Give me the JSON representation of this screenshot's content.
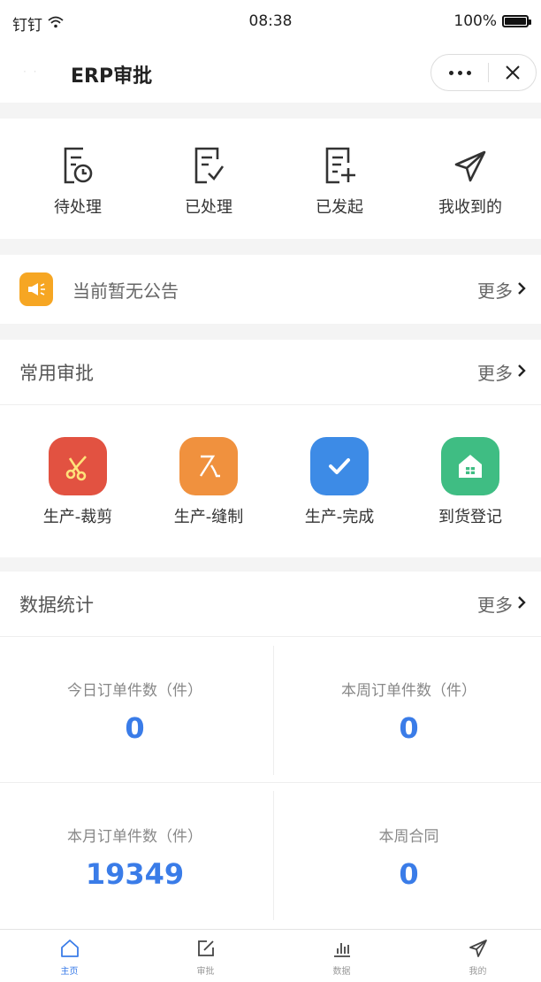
{
  "status_bar": {
    "carrier": "钉钉",
    "time": "08:38",
    "battery": "100%",
    "battery_level": 1.0
  },
  "header": {
    "title": "ERP审批",
    "more_icon": "more-dots-icon",
    "close_icon": "close-icon"
  },
  "quick_actions": [
    {
      "label": "待处理",
      "icon": "pending-clock-icon"
    },
    {
      "label": "已处理",
      "icon": "processed-check-icon"
    },
    {
      "label": "已发起",
      "icon": "initiated-plus-icon"
    },
    {
      "label": "我收到的",
      "icon": "paper-plane-icon"
    }
  ],
  "notice": {
    "text": "当前暂无公告",
    "more": "更多",
    "icon_color": "#f6a623"
  },
  "common_approvals": {
    "title": "常用审批",
    "more": "更多",
    "items": [
      {
        "label": "生产-裁剪",
        "icon": "scissors-icon",
        "color": "#e25241"
      },
      {
        "label": "生产-缝制",
        "icon": "sewing-icon",
        "color": "#f0913e"
      },
      {
        "label": "生产-完成",
        "icon": "check-icon",
        "color": "#3d8be6"
      },
      {
        "label": "到货登记",
        "icon": "house-icon",
        "color": "#3fbd83"
      }
    ]
  },
  "stats": {
    "title": "数据统计",
    "more": "更多",
    "cells": [
      {
        "label": "今日订单件数（件）",
        "value": "0"
      },
      {
        "label": "本周订单件数（件）",
        "value": "0"
      },
      {
        "label": "本月订单件数（件）",
        "value": "19349"
      },
      {
        "label": "本周合同",
        "value": "0"
      }
    ]
  },
  "tabbar": [
    {
      "label": "主页",
      "icon": "home-icon",
      "active": true
    },
    {
      "label": "审批",
      "icon": "edit-icon",
      "active": false
    },
    {
      "label": "数据",
      "icon": "bar-chart-icon",
      "active": false
    },
    {
      "label": "我的",
      "icon": "paper-plane-icon",
      "active": false
    }
  ],
  "colors": {
    "accent": "#3a7ce8",
    "background": "#f4f4f4"
  }
}
